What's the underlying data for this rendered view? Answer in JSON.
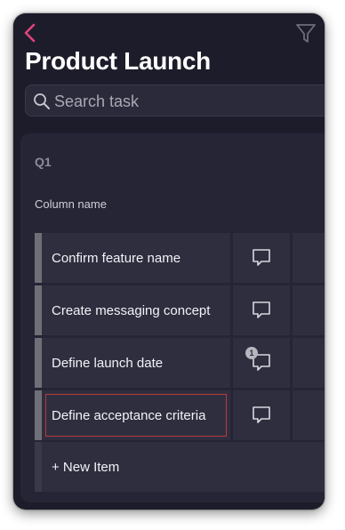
{
  "header": {
    "back_icon": "chevron-left-icon",
    "filter_icon": "filter-icon",
    "title": "Product Launch"
  },
  "search": {
    "placeholder": "Search task",
    "value": ""
  },
  "board": {
    "group_label": "Q1",
    "column_name": "Column name",
    "rows": [
      {
        "label": "Confirm feature name",
        "comments": null,
        "selected": false
      },
      {
        "label": "Create messaging concept",
        "comments": null,
        "selected": false
      },
      {
        "label": "Define launch date",
        "comments": "1",
        "selected": false
      },
      {
        "label": "Define acceptance criteria",
        "comments": null,
        "selected": true
      }
    ],
    "new_item_label": "+ New Item"
  },
  "colors": {
    "accent": "#e0457b",
    "background": "#1d1c2a",
    "panel": "#262536",
    "cell": "#2f2e3f",
    "selected_outline": "#b8393d"
  }
}
